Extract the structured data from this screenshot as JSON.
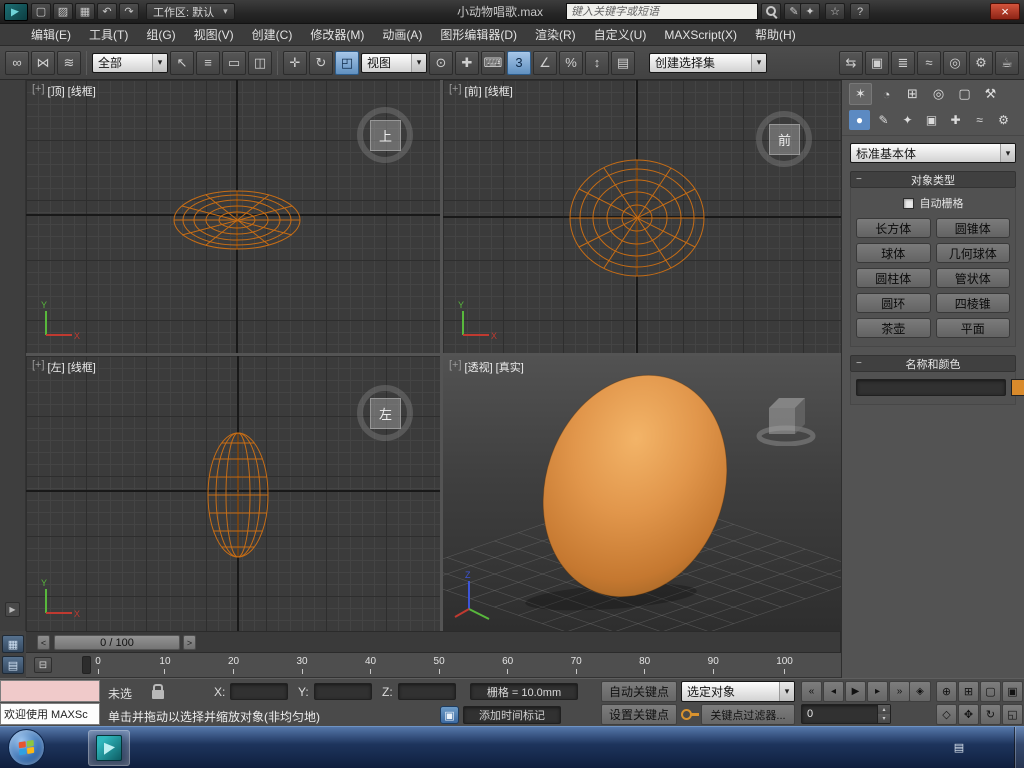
{
  "icons": {
    "caret": "▾",
    "close": "×",
    "pen": "✎",
    "minus": "−",
    "spinner_up": "▴",
    "spinner_down": "▾",
    "flyout": "▶",
    "time_tag": "▣"
  },
  "titlebar": {
    "doc_title": "小动物唱歌.max",
    "workspace": "工作区: 默认",
    "search_placeholder": "键入关键字或短语",
    "file_buttons": [
      {
        "name": "new-scene-button",
        "glyph": "▢"
      },
      {
        "name": "open-file-button",
        "glyph": "▨"
      },
      {
        "name": "save-file-button",
        "glyph": "▦"
      },
      {
        "name": "undo-button",
        "glyph": "↶"
      },
      {
        "name": "redo-button",
        "glyph": "↷"
      }
    ],
    "right_buttons": [
      {
        "name": "sign-in-button",
        "glyph": "✦"
      },
      {
        "name": "favorites-button",
        "glyph": "☆"
      },
      {
        "name": "help-button",
        "glyph": "?"
      }
    ]
  },
  "menubar": {
    "items": [
      {
        "name": "menu-edit",
        "label": "编辑(E)"
      },
      {
        "name": "menu-tools",
        "label": "工具(T)"
      },
      {
        "name": "menu-group",
        "label": "组(G)"
      },
      {
        "name": "menu-views",
        "label": "视图(V)"
      },
      {
        "name": "menu-create",
        "label": "创建(C)"
      },
      {
        "name": "menu-modifiers",
        "label": "修改器(M)"
      },
      {
        "name": "menu-animation",
        "label": "动画(A)"
      },
      {
        "name": "menu-graph-editors",
        "label": "图形编辑器(D)"
      },
      {
        "name": "menu-rendering",
        "label": "渲染(R)"
      },
      {
        "name": "menu-customize",
        "label": "自定义(U)"
      },
      {
        "name": "menu-maxscript",
        "label": "MAXScript(X)"
      },
      {
        "name": "menu-help",
        "label": "帮助(H)"
      }
    ]
  },
  "toolbar": {
    "link_buttons": [
      {
        "name": "select-and-link-button",
        "glyph": "∞"
      },
      {
        "name": "unlink-selection-button",
        "glyph": "⋈"
      },
      {
        "name": "bind-to-space-warp-button",
        "glyph": "≋"
      }
    ],
    "filter_combo": "全部",
    "select_buttons": [
      {
        "name": "select-object-button",
        "glyph": "↖"
      },
      {
        "name": "select-by-name-button",
        "glyph": "≡"
      },
      {
        "name": "rectangular-selection-button",
        "glyph": "▭"
      },
      {
        "name": "window-crossing-button",
        "glyph": "◫"
      }
    ],
    "transform_buttons": [
      {
        "name": "select-and-move-button",
        "glyph": "✛"
      },
      {
        "name": "select-and-rotate-button",
        "glyph": "↻"
      },
      {
        "name": "select-and-scale-button",
        "glyph": "◰",
        "active": true
      }
    ],
    "coord_combo": "视图",
    "mid_buttons": [
      {
        "name": "use-center-button",
        "glyph": "⊙"
      },
      {
        "name": "select-and-manipulate-button",
        "glyph": "✚"
      },
      {
        "name": "keyboard-override-button",
        "glyph": "⌨"
      },
      {
        "name": "snap-toggle-button",
        "glyph": "3",
        "active": true
      },
      {
        "name": "angle-snap-button",
        "glyph": "∠"
      },
      {
        "name": "percent-snap-button",
        "glyph": "%"
      },
      {
        "name": "spinner-snap-button",
        "glyph": "↕"
      },
      {
        "name": "edit-named-selections-button",
        "glyph": "▤"
      }
    ],
    "selection_set_combo": "创建选择集",
    "right_buttons": [
      {
        "name": "mirror-button",
        "glyph": "⇆"
      },
      {
        "name": "align-button",
        "glyph": "▣"
      },
      {
        "name": "layer-manager-button",
        "glyph": "≣"
      },
      {
        "name": "curve-editor-button",
        "glyph": "≈"
      },
      {
        "name": "material-editor-button",
        "glyph": "◎"
      },
      {
        "name": "render-setup-button",
        "glyph": "⚙"
      },
      {
        "name": "render-production-button",
        "glyph": "☕"
      }
    ]
  },
  "viewports": {
    "axes": {
      "x": "X",
      "y": "Y",
      "z": "Z"
    },
    "top": {
      "nav": "[+]",
      "label": "[顶]",
      "shading": "[线框]",
      "cube_face": "上"
    },
    "front": {
      "nav": "[+]",
      "label": "[前]",
      "shading": "[线框]",
      "cube_face": "前"
    },
    "left": {
      "nav": "[+]",
      "label": "[左]",
      "shading": "[线框]",
      "cube_face": "左"
    },
    "persp": {
      "nav": "[+]",
      "label": "[透视]",
      "shading": "[真实]"
    }
  },
  "timeline": {
    "slider_label": "0 / 100",
    "left_arrow": "<",
    "right_arrow": ">",
    "ticks": [
      "0",
      "10",
      "20",
      "30",
      "40",
      "50",
      "60",
      "70",
      "80",
      "90",
      "100"
    ]
  },
  "trackbar": {
    "corner_buttons": [
      {
        "name": "mini-curve-editor-button",
        "glyph": "▦"
      },
      {
        "name": "scene-explorer-button",
        "glyph": "▤"
      }
    ],
    "ruler_buttons": [
      {
        "name": "trackbar-tool-button",
        "glyph": "⊟"
      }
    ]
  },
  "statusbar": {
    "listener_text": "欢迎使用 MAXSc",
    "selection_status": "未选",
    "x_label": "X:",
    "y_label": "Y:",
    "z_label": "Z:",
    "grid_value": "栅格 = 10.0mm",
    "prompt": "单击并拖动以选择并缩放对象(非均匀地)",
    "add_time_tag": "添加时间标记"
  },
  "animation": {
    "auto_key": "自动关键点",
    "set_key": "设置关键点",
    "key_mode_combo": "选定对象",
    "key_filters": "关键点过滤器...",
    "frame_value": "0",
    "key_toggle_glyph": "◈",
    "playback": [
      {
        "name": "go-to-start-button",
        "glyph": "«"
      },
      {
        "name": "previous-frame-button",
        "glyph": "◂"
      },
      {
        "name": "play-animation-button",
        "glyph": "▶"
      },
      {
        "name": "next-frame-button",
        "glyph": "▸"
      },
      {
        "name": "go-to-end-button",
        "glyph": "»"
      }
    ]
  },
  "nav": {
    "row1": [
      {
        "name": "zoom-button",
        "glyph": "⊕"
      },
      {
        "name": "zoom-all-button",
        "glyph": "⊞"
      },
      {
        "name": "zoom-extents-button",
        "glyph": "▢"
      },
      {
        "name": "zoom-extents-all-button",
        "glyph": "▣"
      }
    ],
    "row2": [
      {
        "name": "field-of-view-button",
        "glyph": "◇"
      },
      {
        "name": "pan-view-button",
        "glyph": "✥"
      },
      {
        "name": "orbit-viewport-button",
        "glyph": "↻"
      },
      {
        "name": "maximize-viewport-toggle-button",
        "glyph": "◱"
      }
    ]
  },
  "command_panel": {
    "tabs": [
      {
        "name": "tab-create",
        "glyph": "✶",
        "active": true
      },
      {
        "name": "tab-modify",
        "glyph": "◔"
      },
      {
        "name": "tab-hierarchy",
        "glyph": "⊞"
      },
      {
        "name": "tab-motion",
        "glyph": "◎"
      },
      {
        "name": "tab-display",
        "glyph": "▢"
      },
      {
        "name": "tab-utilities",
        "glyph": "⚒"
      }
    ],
    "categories": [
      {
        "name": "category-geometry",
        "glyph": "●",
        "active": true
      },
      {
        "name": "category-shapes",
        "glyph": "✎"
      },
      {
        "name": "category-lights",
        "glyph": "✦"
      },
      {
        "name": "category-cameras",
        "glyph": "▣"
      },
      {
        "name": "category-helpers",
        "glyph": "✚"
      },
      {
        "name": "category-space-warps",
        "glyph": "≈"
      },
      {
        "name": "category-systems",
        "glyph": "⚙"
      }
    ],
    "category_combo": "标准基本体",
    "object_type_rollout": "对象类型",
    "autogrid_label": "自动栅格",
    "primitives": [
      {
        "name": "box-button",
        "label": "长方体"
      },
      {
        "name": "cone-button",
        "label": "圆锥体"
      },
      {
        "name": "sphere-button",
        "label": "球体"
      },
      {
        "name": "geosphere-button",
        "label": "几何球体"
      },
      {
        "name": "cylinder-button",
        "label": "圆柱体"
      },
      {
        "name": "tube-button",
        "label": "管状体"
      },
      {
        "name": "torus-button",
        "label": "圆环"
      },
      {
        "name": "pyramid-button",
        "label": "四棱锥"
      },
      {
        "name": "teapot-button",
        "label": "茶壶"
      },
      {
        "name": "plane-button",
        "label": "平面"
      }
    ],
    "name_color_rollout": "名称和颜色",
    "object_color": "#d98a2b"
  }
}
